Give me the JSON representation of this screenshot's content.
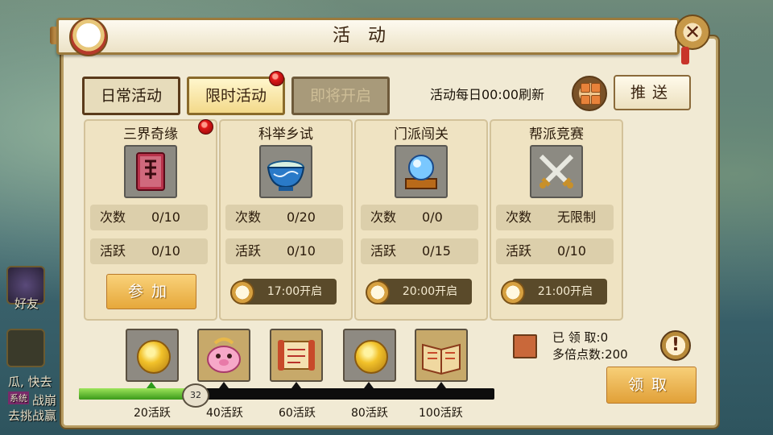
{
  "window": {
    "title": "活动"
  },
  "tabs": [
    {
      "label": "日常活动",
      "state": "default"
    },
    {
      "label": "限时活动",
      "state": "selected",
      "badge": true
    },
    {
      "label": "即将开启",
      "state": "disabled"
    }
  ],
  "header": {
    "refresh_text": "活动每日00:00刷新",
    "push_label": "推送"
  },
  "activities": [
    {
      "name": "三界奇缘",
      "icon": "red-book-icon",
      "count_label": "次数",
      "count": "0/10",
      "active_label": "活跃",
      "active": "0/10",
      "action": "参加",
      "badge": true
    },
    {
      "name": "科举乡试",
      "icon": "porcelain-bowl-icon",
      "count_label": "次数",
      "count": "0/20",
      "active_label": "活跃",
      "active": "0/10",
      "open_time": "17:00开启"
    },
    {
      "name": "门派闯关",
      "icon": "crystal-ball-icon",
      "count_label": "次数",
      "count": "0/0",
      "active_label": "活跃",
      "active": "0/15",
      "open_time": "20:00开启"
    },
    {
      "name": "帮派竞赛",
      "icon": "crossed-swords-icon",
      "count_label": "次数",
      "count": "无限制",
      "active_label": "活跃",
      "active": "0/10",
      "open_time": "21:00开启"
    }
  ],
  "progress": {
    "current": "32",
    "current_value": 32,
    "max_value": 100,
    "milestones": [
      {
        "label": "20活跃",
        "value": 20,
        "icon": "gold-coin-icon"
      },
      {
        "label": "40活跃",
        "value": 40,
        "icon": "pig-treasure-icon"
      },
      {
        "label": "60活跃",
        "value": 60,
        "icon": "scroll-icon"
      },
      {
        "label": "80活跃",
        "value": 80,
        "icon": "gold-coin-icon"
      },
      {
        "label": "100活跃",
        "value": 100,
        "icon": "open-book-icon"
      }
    ]
  },
  "claim": {
    "claimed_label": "已 领 取:",
    "claimed_value": "0",
    "points_label": "多倍点数:",
    "points_value": "200",
    "button_label": "领取",
    "info_symbol": "!"
  },
  "side": {
    "friends_label": "好友",
    "chat_line1": "瓜, 快去",
    "chat_line2": "战崩",
    "chat_line3": "去挑战赢",
    "system_tag": "系统"
  },
  "colors": {
    "accent_green": "#3a9a1a",
    "badge_red": "#e01818",
    "gold": "#e6a83a"
  }
}
